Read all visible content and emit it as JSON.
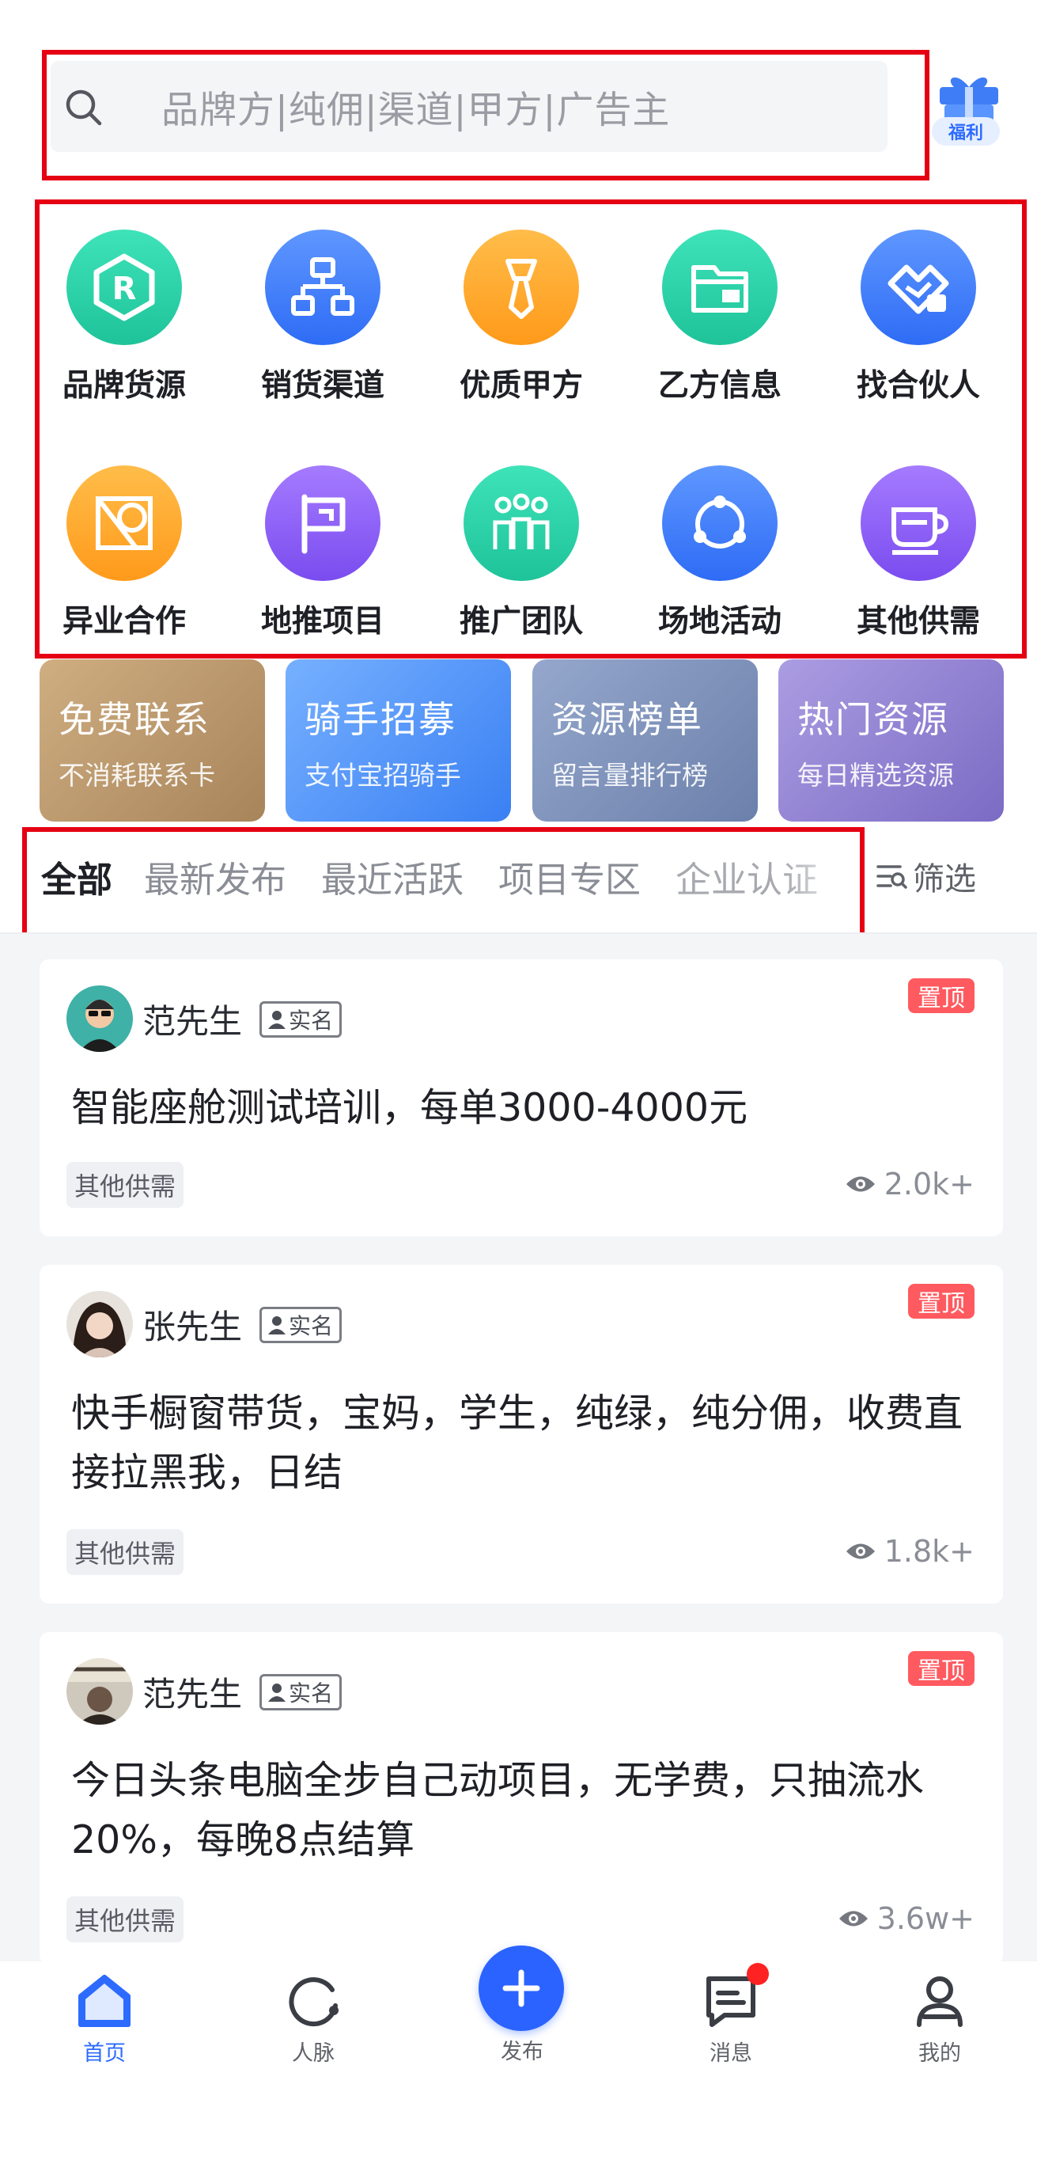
{
  "search": {
    "placeholder": "品牌方|纯佣|渠道|甲方|广告主",
    "welfare_label": "福利"
  },
  "categories": [
    {
      "label": "品牌货源",
      "icon": "brand-r-icon",
      "color": "#29d3a9"
    },
    {
      "label": "销货渠道",
      "icon": "org-chart-icon",
      "color": "#3e7cff"
    },
    {
      "label": "优质甲方",
      "icon": "tie-icon",
      "color": "#ffa72d"
    },
    {
      "label": "乙方信息",
      "icon": "folder-icon",
      "color": "#29d3a9"
    },
    {
      "label": "找合伙人",
      "icon": "handshake-icon",
      "color": "#3e7cff"
    },
    {
      "label": "异业合作",
      "icon": "shapes-icon",
      "color": "#ffa72d"
    },
    {
      "label": "地推项目",
      "icon": "flag-icon",
      "color": "#8a5cf5"
    },
    {
      "label": "推广团队",
      "icon": "team-icon",
      "color": "#29d3a9"
    },
    {
      "label": "场地活动",
      "icon": "venue-circle-icon",
      "color": "#3e7cff"
    },
    {
      "label": "其他供需",
      "icon": "cup-icon",
      "color": "#8a5cf5"
    }
  ],
  "promos": [
    {
      "title": "免费联系",
      "subtitle": "不消耗联系卡",
      "color_from": "#c9a77a",
      "color_to": "#ae8b5c"
    },
    {
      "title": "骑手招募",
      "subtitle": "支付宝招骑手",
      "color_from": "#6aa8ff",
      "color_to": "#3d84f5"
    },
    {
      "title": "资源榜单",
      "subtitle": "留言量排行榜",
      "color_from": "#8d9fc4",
      "color_to": "#6f83ad"
    },
    {
      "title": "热门资源",
      "subtitle": "每日精选资源",
      "color_from": "#a394dd",
      "color_to": "#7f6fc6"
    }
  ],
  "tabs": {
    "items": [
      "全部",
      "最新发布",
      "最近活跃",
      "项目专区",
      "企业认证"
    ],
    "active_index": 0,
    "filter_label": "筛选"
  },
  "feed": [
    {
      "author": "范先生",
      "verified_label": "实名",
      "pin_label": "置顶",
      "title": "智能座舱测试培训，每单3000-4000元",
      "tag": "其他供需",
      "views": "2.0k+"
    },
    {
      "author": "张先生",
      "verified_label": "实名",
      "pin_label": "置顶",
      "title": "快手橱窗带货，宝妈，学生，纯绿，纯分佣，收费直接拉黑我，日结",
      "tag": "其他供需",
      "views": "1.8k+"
    },
    {
      "author": "范先生",
      "verified_label": "实名",
      "pin_label": "置顶",
      "title": "今日头条电脑全步自己动项目，无学费，只抽流水20%，每晚8点结算",
      "tag": "其他供需",
      "views": "3.6w+"
    }
  ],
  "bottom_nav": {
    "home": "首页",
    "network": "人脉",
    "publish": "发布",
    "messages": "消息",
    "mine": "我的",
    "active": "home",
    "accent": "#2d6bff"
  }
}
